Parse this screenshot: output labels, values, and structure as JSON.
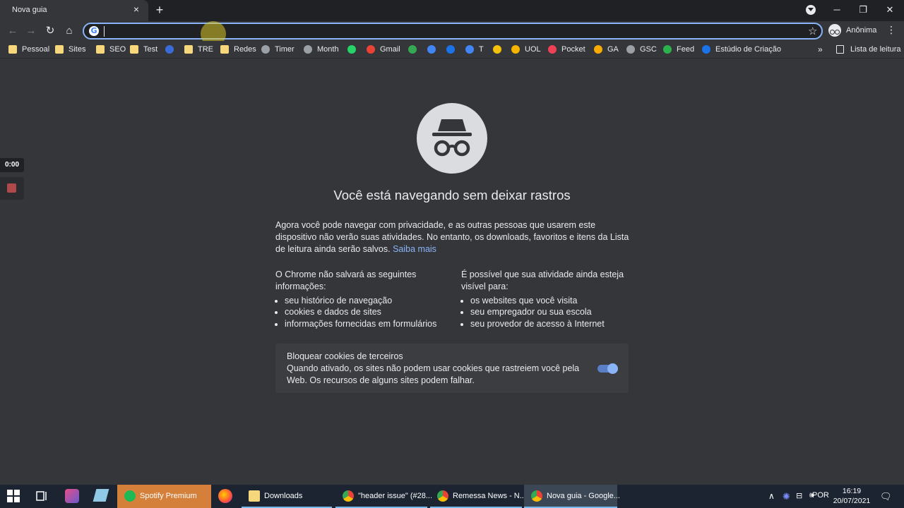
{
  "tab": {
    "title": "Nova guia",
    "close": "×",
    "new_tab": "+"
  },
  "window_controls": {
    "minimize": "─",
    "maximize": "❐",
    "close": "✕"
  },
  "toolbar": {
    "back": "←",
    "forward": "→",
    "reload": "↻",
    "home": "⌂",
    "omnibox_value": "",
    "bookmark_star": "☆",
    "profile_label": "Anônima",
    "menu": "⋮"
  },
  "bookmarks": [
    {
      "label": "Pessoal",
      "icon": "folder-icon",
      "color": "#f6d77b"
    },
    {
      "label": "Sites",
      "icon": "folder-icon",
      "color": "#f6d77b"
    },
    {
      "label": "SEO",
      "icon": "folder-icon",
      "color": "#f6d77b"
    },
    {
      "label": "Test",
      "icon": "folder-icon",
      "color": "#f6d77b"
    },
    {
      "label": "",
      "icon": "app-icon",
      "color": "#3b6bd6"
    },
    {
      "label": "TRE",
      "icon": "folder-icon",
      "color": "#f6d77b"
    },
    {
      "label": "Redes",
      "icon": "folder-icon",
      "color": "#f6d77b"
    },
    {
      "label": "Timer",
      "icon": "timer-icon",
      "color": "#9aa0a6"
    },
    {
      "label": "Month",
      "icon": "timer-icon",
      "color": "#9aa0a6"
    },
    {
      "label": "",
      "icon": "whatsapp-icon",
      "color": "#25d366"
    },
    {
      "label": "Gmail",
      "icon": "gmail-icon",
      "color": "#ea4335"
    },
    {
      "label": "",
      "icon": "drive-icon",
      "color": "#34a853"
    },
    {
      "label": "",
      "icon": "calendar-icon",
      "color": "#4285f4"
    },
    {
      "label": "",
      "icon": "contacts-icon",
      "color": "#1a73e8"
    },
    {
      "label": "T",
      "icon": "translate-icon",
      "color": "#4285f4"
    },
    {
      "label": "",
      "icon": "euro-icon",
      "color": "#f4c20d"
    },
    {
      "label": "UOL",
      "icon": "uol-icon",
      "color": "#f4b400"
    },
    {
      "label": "Pocket",
      "icon": "pocket-icon",
      "color": "#ef4056"
    },
    {
      "label": "GA",
      "icon": "analytics-icon",
      "color": "#f9ab00"
    },
    {
      "label": "GSC",
      "icon": "search-console-icon",
      "color": "#9aa0a6"
    },
    {
      "label": "Feed",
      "icon": "feedly-icon",
      "color": "#2bb24c"
    },
    {
      "label": "Estúdio de Criação",
      "icon": "studio-icon",
      "color": "#1a73e8"
    }
  ],
  "bookmarks_more": "»",
  "reading_list": "Lista de leitura",
  "recorder": {
    "time": "0:00"
  },
  "incognito": {
    "headline": "Você está navegando sem deixar rastros",
    "paragraph": "Agora você pode navegar com privacidade, e as outras pessoas que usarem este dispositivo não verão suas atividades. No entanto, os downloads, favoritos e itens da Lista de leitura ainda serão salvos.",
    "learn_more": "Saiba mais",
    "left_heading": "O Chrome não salvará as seguintes informações:",
    "left_items": [
      "seu histórico de navegação",
      "cookies e dados de sites",
      "informações fornecidas em formulários"
    ],
    "right_heading": "É possível que sua atividade ainda esteja visível para:",
    "right_items": [
      "os websites que você visita",
      "seu empregador ou sua escola",
      "seu provedor de acesso à Internet"
    ],
    "cookie_title": "Bloquear cookies de terceiros",
    "cookie_desc": "Quando ativado, os sites não podem usar cookies que rastreiem você pela Web. Os recursos de alguns sites podem falhar.",
    "cookie_toggle_on": true
  },
  "taskbar": {
    "apps": [
      {
        "label": "Spotify Premium",
        "icon": "spotify-icon",
        "color": "#1db954"
      },
      {
        "label": "Downloads",
        "icon": "folder-icon",
        "color": "#f6d77b"
      },
      {
        "label": "\"header issue\" (#28...",
        "icon": "chrome-icon",
        "color": "#4285f4"
      },
      {
        "label": "Remessa News - N...",
        "icon": "chrome-icon",
        "color": "#4285f4"
      },
      {
        "label": "Nova guia - Google...",
        "icon": "chrome-icon",
        "color": "#4285f4"
      }
    ],
    "language": "POR",
    "time": "16:19",
    "date": "20/07/2021"
  }
}
